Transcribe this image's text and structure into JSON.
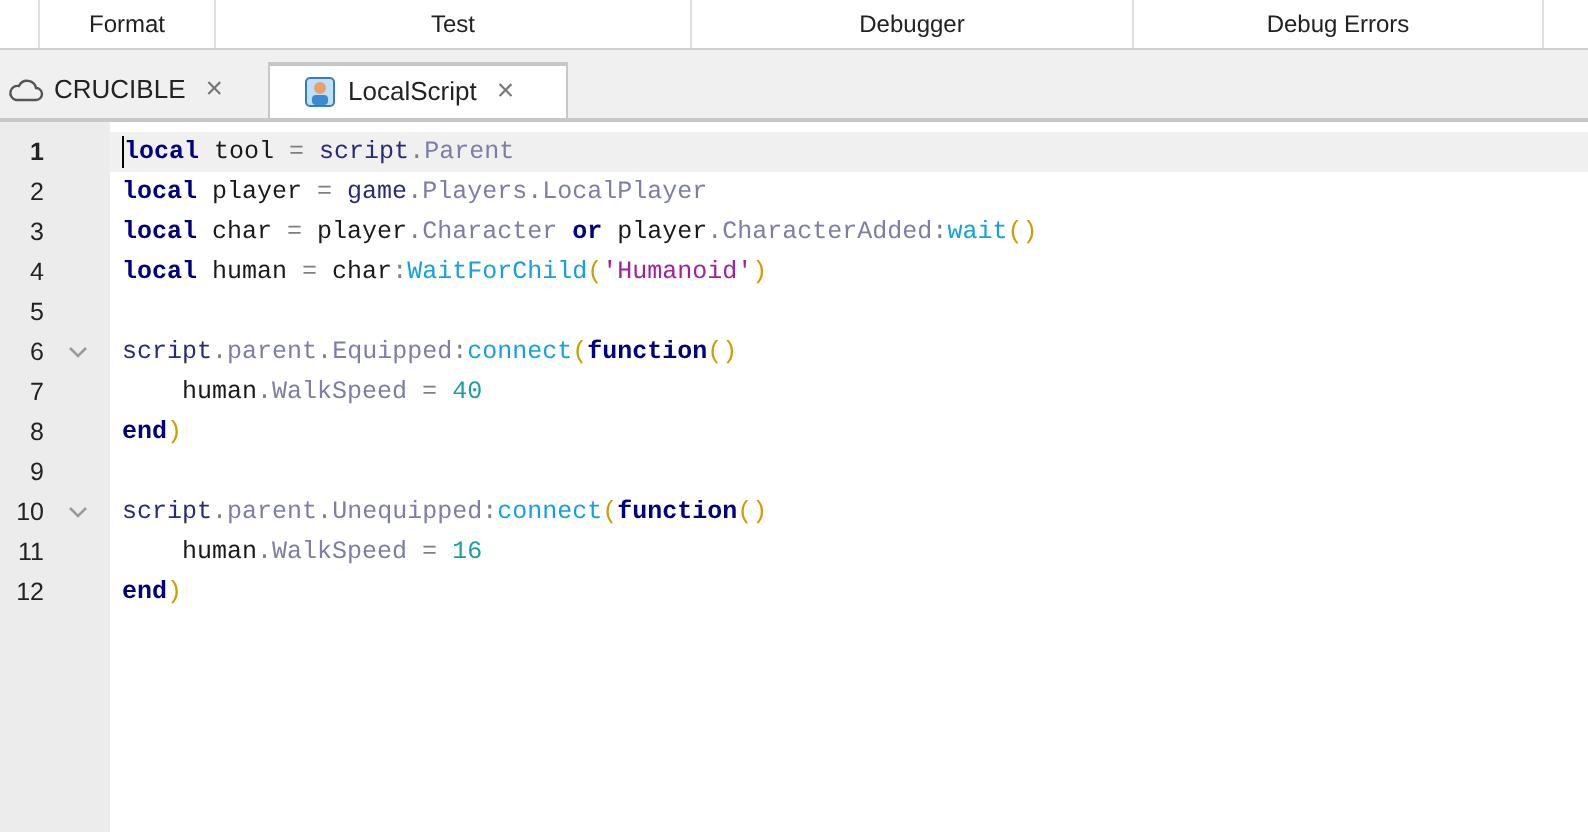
{
  "toolbar": {
    "sections": [
      "Format",
      "Test",
      "Debugger",
      "Debug Errors"
    ]
  },
  "tabs": [
    {
      "label": "CRUCIBLE",
      "kind": "place",
      "selected": false,
      "close": "×"
    },
    {
      "label": "LocalScript",
      "kind": "script",
      "selected": true,
      "close": "×"
    }
  ],
  "editor": {
    "lines": [
      {
        "number": "1",
        "current": true,
        "fold": false,
        "tokens": [
          {
            "kind": "kw",
            "text": "local"
          },
          {
            "kind": "id",
            "text": " tool "
          },
          {
            "kind": "op",
            "text": "= "
          },
          {
            "kind": "builtin",
            "text": "script"
          },
          {
            "kind": "op",
            "text": "."
          },
          {
            "kind": "prop",
            "text": "Parent"
          }
        ]
      },
      {
        "number": "2",
        "current": false,
        "fold": false,
        "tokens": [
          {
            "kind": "kw",
            "text": "local"
          },
          {
            "kind": "id",
            "text": " player "
          },
          {
            "kind": "op",
            "text": "= "
          },
          {
            "kind": "builtin",
            "text": "game"
          },
          {
            "kind": "op",
            "text": "."
          },
          {
            "kind": "prop",
            "text": "Players"
          },
          {
            "kind": "op",
            "text": "."
          },
          {
            "kind": "prop",
            "text": "LocalPlayer"
          }
        ]
      },
      {
        "number": "3",
        "current": false,
        "fold": false,
        "tokens": [
          {
            "kind": "kw",
            "text": "local"
          },
          {
            "kind": "id",
            "text": " char "
          },
          {
            "kind": "op",
            "text": "="
          },
          {
            "kind": "id",
            "text": " player"
          },
          {
            "kind": "op",
            "text": "."
          },
          {
            "kind": "prop",
            "text": "Character"
          },
          {
            "kind": "kw",
            "text": " or"
          },
          {
            "kind": "id",
            "text": " player"
          },
          {
            "kind": "op",
            "text": "."
          },
          {
            "kind": "prop",
            "text": "CharacterAdded"
          },
          {
            "kind": "op",
            "text": ":"
          },
          {
            "kind": "method",
            "text": "wait"
          },
          {
            "kind": "paren",
            "text": "()"
          }
        ]
      },
      {
        "number": "4",
        "current": false,
        "fold": false,
        "tokens": [
          {
            "kind": "kw",
            "text": "local"
          },
          {
            "kind": "id",
            "text": " human "
          },
          {
            "kind": "op",
            "text": "="
          },
          {
            "kind": "id",
            "text": " char"
          },
          {
            "kind": "op",
            "text": ":"
          },
          {
            "kind": "method",
            "text": "WaitForChild"
          },
          {
            "kind": "paren",
            "text": "("
          },
          {
            "kind": "str",
            "text": "'Humanoid'"
          },
          {
            "kind": "paren",
            "text": ")"
          }
        ]
      },
      {
        "number": "5",
        "current": false,
        "fold": false
      },
      {
        "number": "6",
        "current": false,
        "fold": true,
        "tokens": [
          {
            "kind": "builtin",
            "text": "script"
          },
          {
            "kind": "op",
            "text": "."
          },
          {
            "kind": "prop",
            "text": "parent"
          },
          {
            "kind": "op",
            "text": "."
          },
          {
            "kind": "prop",
            "text": "Equipped"
          },
          {
            "kind": "op",
            "text": ":"
          },
          {
            "kind": "method",
            "text": "connect"
          },
          {
            "kind": "paren",
            "text": "("
          },
          {
            "kind": "kw",
            "text": "function"
          },
          {
            "kind": "paren",
            "text": "()"
          }
        ]
      },
      {
        "number": "7",
        "current": false,
        "fold": false,
        "tokens": [
          {
            "kind": "id",
            "text": "    human"
          },
          {
            "kind": "op",
            "text": "."
          },
          {
            "kind": "prop",
            "text": "WalkSpeed"
          },
          {
            "kind": "op",
            "text": " = "
          },
          {
            "kind": "num",
            "text": "40"
          }
        ]
      },
      {
        "number": "8",
        "current": false,
        "fold": false,
        "tokens": [
          {
            "kind": "kw",
            "text": "end"
          },
          {
            "kind": "paren",
            "text": ")"
          }
        ]
      },
      {
        "number": "9",
        "current": false,
        "fold": false
      },
      {
        "number": "10",
        "current": false,
        "fold": true,
        "tokens": [
          {
            "kind": "builtin",
            "text": "script"
          },
          {
            "kind": "op",
            "text": "."
          },
          {
            "kind": "prop",
            "text": "parent"
          },
          {
            "kind": "op",
            "text": "."
          },
          {
            "kind": "prop",
            "text": "Unequipped"
          },
          {
            "kind": "op",
            "text": ":"
          },
          {
            "kind": "method",
            "text": "connect"
          },
          {
            "kind": "paren",
            "text": "("
          },
          {
            "kind": "kw",
            "text": "function"
          },
          {
            "kind": "paren",
            "text": "()"
          }
        ]
      },
      {
        "number": "11",
        "current": false,
        "fold": false,
        "tokens": [
          {
            "kind": "id",
            "text": "    human"
          },
          {
            "kind": "op",
            "text": "."
          },
          {
            "kind": "prop",
            "text": "WalkSpeed"
          },
          {
            "kind": "op",
            "text": " = "
          },
          {
            "kind": "num",
            "text": "16"
          }
        ]
      },
      {
        "number": "12",
        "current": false,
        "fold": false,
        "tokens": [
          {
            "kind": "kw",
            "text": "end"
          },
          {
            "kind": "paren",
            "text": ")"
          }
        ]
      }
    ]
  }
}
